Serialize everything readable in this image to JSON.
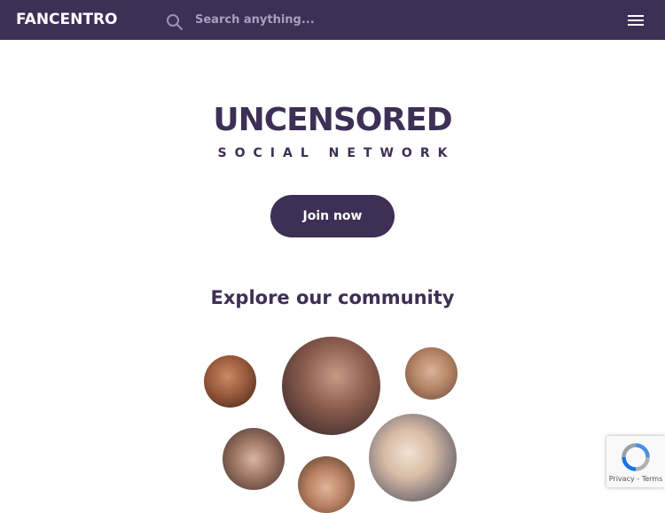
{
  "header": {
    "logo_text": "FANCENTRO",
    "search_placeholder": "Search anything...",
    "search_value": ""
  },
  "hero": {
    "title": "UNCENSORED",
    "subtitle": "SOCIAL NETWORK",
    "cta_label": "Join now"
  },
  "community": {
    "heading": "Explore our community"
  },
  "recaptcha": {
    "privacy_label": "Privacy",
    "separator": " - ",
    "terms_label": "Terms"
  },
  "colors": {
    "brand": "#3d2f55",
    "background": "#ffffff"
  },
  "icons": {
    "search": "search-icon",
    "menu": "menu-icon",
    "recaptcha": "recaptcha-icon"
  }
}
